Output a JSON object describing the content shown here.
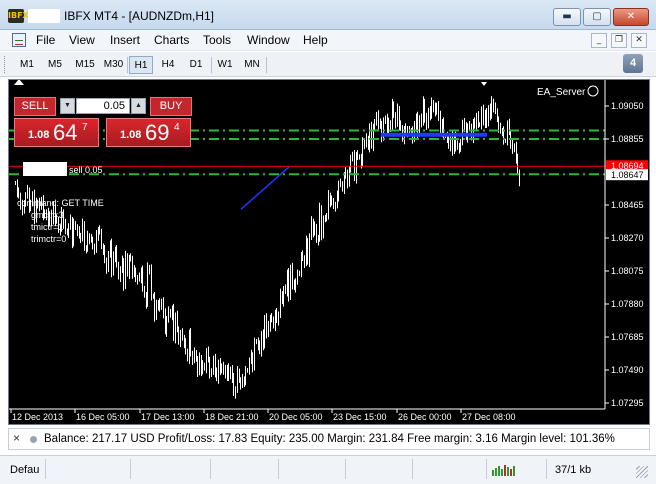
{
  "window": {
    "app_icon_label": "IBFX",
    "title": "IBFX MT4 - [AUDNZDm,H1]",
    "controls": {
      "minimize": "▬",
      "maximize": "▢",
      "close": "✕"
    }
  },
  "menu": {
    "items": [
      "File",
      "View",
      "Insert",
      "Charts",
      "Tools",
      "Window",
      "Help"
    ],
    "mdi": {
      "minimize": "_",
      "restore": "❐",
      "close": "✕"
    }
  },
  "timeframes": {
    "items": [
      "M1",
      "M5",
      "M15",
      "M30",
      "H1",
      "H4",
      "D1",
      "W1",
      "MN"
    ],
    "active": "H1"
  },
  "alerts_badge": "4",
  "one_click": {
    "sell_label": "SELL",
    "buy_label": "BUY",
    "lot": "0.05",
    "sell_price": {
      "prefix": "1.08",
      "big": "64",
      "sup": "7"
    },
    "buy_price": {
      "prefix": "1.08",
      "big": "69",
      "sup": "4"
    }
  },
  "chart": {
    "ea_label": "EA_Server",
    "order_label": "sell 0.05",
    "comment_lines": [
      "command: GET TIME",
      "gmctr=3",
      "tmictr=1",
      "trimctr=0"
    ],
    "price_axis": [
      "1.09050",
      "1.08855",
      "1.08465",
      "1.08270",
      "1.08075",
      "1.07880",
      "1.07685",
      "1.07490",
      "1.07295"
    ],
    "bid_label": "1.08694",
    "order_price_label": "1.08647",
    "time_axis": [
      "12 Dec 2013",
      "16 Dec 05:00",
      "17 Dec 13:00",
      "18 Dec 21:00",
      "20 Dec 05:00",
      "23 Dec 15:00",
      "26 Dec 00:00",
      "27 Dec 08:00"
    ],
    "colors": {
      "background": "#000000",
      "bars": "#ffffff",
      "levels": "#2fb82f",
      "bid": "#ff0000",
      "ea_line": "#1d3bff"
    },
    "series": [
      1.08595,
      1.08538,
      1.08521,
      1.08469,
      1.08426,
      1.08482,
      1.08519,
      1.08552,
      1.08451,
      1.08469,
      1.08534,
      1.08378,
      1.08476,
      1.0848,
      1.08449,
      1.08501,
      1.08402,
      1.08407,
      1.08422,
      1.08351,
      1.08416,
      1.08367,
      1.08455,
      1.08376,
      1.08382,
      1.08312,
      1.08324,
      1.08422,
      1.08356,
      1.08314,
      1.08297,
      1.08335,
      1.08377,
      1.08242,
      1.08358,
      1.08329,
      1.08308,
      1.08283,
      1.08272,
      1.08358,
      1.08206,
      1.08206,
      1.08281,
      1.08265,
      1.08266,
      1.08215,
      1.08199,
      1.08285,
      1.08318,
      1.08313,
      1.08216,
      1.08197,
      1.08138,
      1.08091,
      1.08166,
      1.08244,
      1.08065,
      1.08159,
      1.08202,
      1.08118,
      1.08037,
      1.08081,
      1.08134,
      1.0799,
      1.08168,
      1.08054,
      1.08148,
      1.08148,
      1.08061,
      1.08083,
      1.08022,
      1.08029,
      1.08034,
      1.08079,
      1.07975,
      1.07929,
      1.0788,
      1.08094,
      1.08087,
      1.07923,
      1.07929,
      1.07803,
      1.07874,
      1.07887,
      1.07857,
      1.07898,
      1.07822,
      1.07718,
      1.07792,
      1.07839,
      1.07811,
      1.07849,
      1.07679,
      1.07813,
      1.07735,
      1.07652,
      1.07705,
      1.0768,
      1.07651,
      1.07604,
      1.07553,
      1.07706,
      1.07587,
      1.07552,
      1.07596,
      1.07551,
      1.07476,
      1.07562,
      1.07486,
      1.07521,
      1.07498,
      1.07597,
      1.07551,
      1.07471,
      1.07473,
      1.07563,
      1.07473,
      1.07441,
      1.07534,
      1.07482,
      1.07517,
      1.07488,
      1.07457,
      1.07503,
      1.07447,
      1.07497,
      1.0744,
      1.07353,
      1.07377,
      1.07486,
      1.07426,
      1.07401,
      1.07435,
      1.07421,
      1.07486,
      1.0749,
      1.07542,
      1.07578,
      1.07508,
      1.07654,
      1.07661,
      1.07633,
      1.07601,
      1.07703,
      1.07629,
      1.07803,
      1.07703,
      1.07748,
      1.07799,
      1.07794,
      1.07747,
      1.07824,
      1.07785,
      1.07819,
      1.07944,
      1.07891,
      1.07964,
      1.07956,
      1.08066,
      1.07916,
      1.08101,
      1.07993,
      1.0798,
      1.08015,
      1.08057,
      1.08065,
      1.08165,
      1.08151,
      1.08125,
      1.08257,
      1.08125,
      1.08275,
      1.08367,
      1.08306,
      1.08341,
      1.08253,
      1.08265,
      1.08447,
      1.08289,
      1.08376,
      1.08395,
      1.08396,
      1.08521,
      1.08484,
      1.08494,
      1.08453,
      1.08462,
      1.08518,
      1.08592,
      1.08594,
      1.08557,
      1.08637,
      1.08657,
      1.08595,
      1.08668,
      1.0875,
      1.08758,
      1.08624,
      1.08762,
      1.08753,
      1.08745,
      1.08708,
      1.08834,
      1.08827,
      1.08862,
      1.08803,
      1.08925,
      1.08815,
      1.08928,
      1.08946,
      1.09003,
      1.08932,
      1.08945,
      1.08867,
      1.08956,
      1.08982,
      1.08905,
      1.08949,
      1.08928,
      1.09065,
      1.08992,
      1.08944,
      1.09033,
      1.08938,
      1.08925,
      1.08851,
      1.08909,
      1.08915,
      1.08897,
      1.08905,
      1.08908,
      1.08855,
      1.08929,
      1.08989,
      1.08881,
      1.08984,
      1.08951,
      1.09075,
      1.08983,
      1.0893,
      1.09028,
      1.08992,
      1.09068,
      1.09044,
      1.0901,
      1.09058,
      1.0899,
      1.08899,
      1.08956,
      1.08873,
      1.08876,
      1.08858,
      1.08814,
      1.08873,
      1.08778,
      1.08876,
      1.08808,
      1.08815,
      1.08801,
      1.08829,
      1.08957,
      1.08923,
      1.08866,
      1.0893,
      1.08934,
      1.08858,
      1.08951,
      1.08933,
      1.08993,
      1.08942,
      1.08939,
      1.09026,
      1.08952,
      1.09011,
      1.08942,
      1.09043,
      1.08992,
      1.09076,
      1.09044,
      1.09024,
      1.08967,
      1.08919,
      1.08903,
      1.08903,
      1.08844,
      1.08844,
      1.08943,
      1.08895,
      1.08829,
      1.08789,
      1.08817,
      1.08736,
      1.08658,
      1.08608
    ]
  },
  "account": {
    "close": "×",
    "text": "Balance: 217.17 USD  Profit/Loss: 17.83  Equity: 235.00  Margin: 231.84  Free margin: 3.16  Margin level: 101.36%"
  },
  "status": {
    "profile": "Default",
    "traffic": "37/1 kb"
  }
}
